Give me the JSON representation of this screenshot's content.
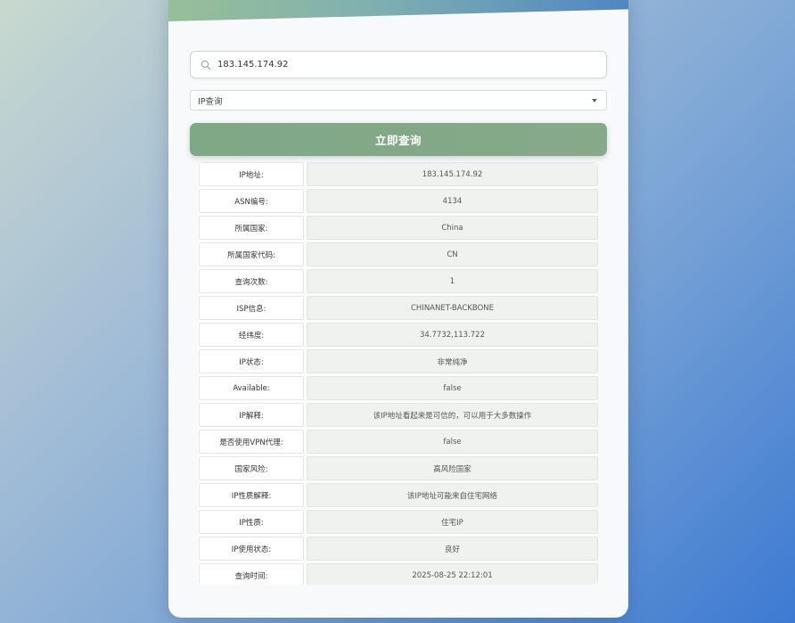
{
  "search": {
    "value": "183.145.174.92",
    "icon": "search-icon"
  },
  "query_type": {
    "selected": "IP查询"
  },
  "button": {
    "label": "立即查询"
  },
  "results": [
    {
      "key": "IP地址:",
      "value": "183.145.174.92"
    },
    {
      "key": "ASN编号:",
      "value": "4134"
    },
    {
      "key": "所属国家:",
      "value": "China"
    },
    {
      "key": "所属国家代码:",
      "value": "CN"
    },
    {
      "key": "查询次数:",
      "value": "1"
    },
    {
      "key": "ISP信息:",
      "value": "CHINANET-BACKBONE"
    },
    {
      "key": "经纬度:",
      "value": "34.7732,113.722"
    },
    {
      "key": "IP状态:",
      "value": "非常纯净"
    },
    {
      "key": "Available:",
      "value": "false"
    },
    {
      "key": "IP解释:",
      "value": "该IP地址看起来是可信的，可以用于大多数操作"
    },
    {
      "key": "是否使用VPN代理:",
      "value": "false"
    },
    {
      "key": "国家风险:",
      "value": "高风险国家"
    },
    {
      "key": "IP性质解释:",
      "value": "该IP地址可能来自住宅网络"
    },
    {
      "key": "IP性质:",
      "value": "住宅IP"
    },
    {
      "key": "IP使用状态:",
      "value": "良好"
    },
    {
      "key": "查询时间:",
      "value": "2025-08-25 22:12:01"
    }
  ],
  "colors": {
    "button": "#7fa887",
    "header_start": "#98bf98",
    "header_end": "#4f86c4",
    "value_cell": "#eff2ef"
  }
}
